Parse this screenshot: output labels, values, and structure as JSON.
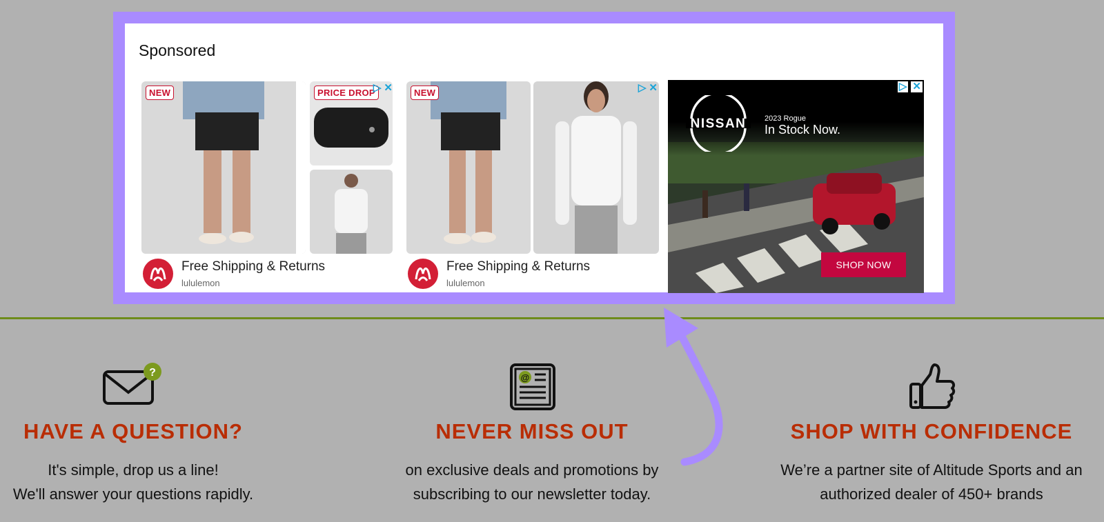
{
  "sponsored_label": "Sponsored",
  "ads": [
    {
      "badges": [
        "NEW",
        "PRICE DROP"
      ],
      "title": "Free Shipping & Returns",
      "brand": "lululemon"
    },
    {
      "badges": [
        "NEW"
      ],
      "title": "Free Shipping & Returns",
      "brand": "lululemon"
    }
  ],
  "nissan_ad": {
    "logo_text": "NISSAN",
    "model_year": "2023 Rogue",
    "headline": "In Stock Now.",
    "cta": "SHOP NOW"
  },
  "features": [
    {
      "icon": "mail-question-icon",
      "title": "HAVE A QUESTION?",
      "lines": [
        "It's simple, drop us a line!",
        "We'll answer your questions rapidly."
      ]
    },
    {
      "icon": "newspaper-icon",
      "title": "NEVER MISS OUT",
      "lines": [
        "on exclusive deals and promotions by",
        "subscribing to our newsletter today."
      ]
    },
    {
      "icon": "thumbs-up-icon",
      "title": "SHOP WITH CONFIDENCE",
      "lines": [
        "We’re a partner site of Altitude Sports and an",
        "authorized dealer of 450+ brands"
      ]
    }
  ],
  "colors": {
    "page_bg": "#b1b1b1",
    "highlight": "#a98bff",
    "divider": "#6e8c1a",
    "feature_title": "#b92d05",
    "lulu_red": "#d31f36",
    "nissan_cta": "#c3073f"
  }
}
